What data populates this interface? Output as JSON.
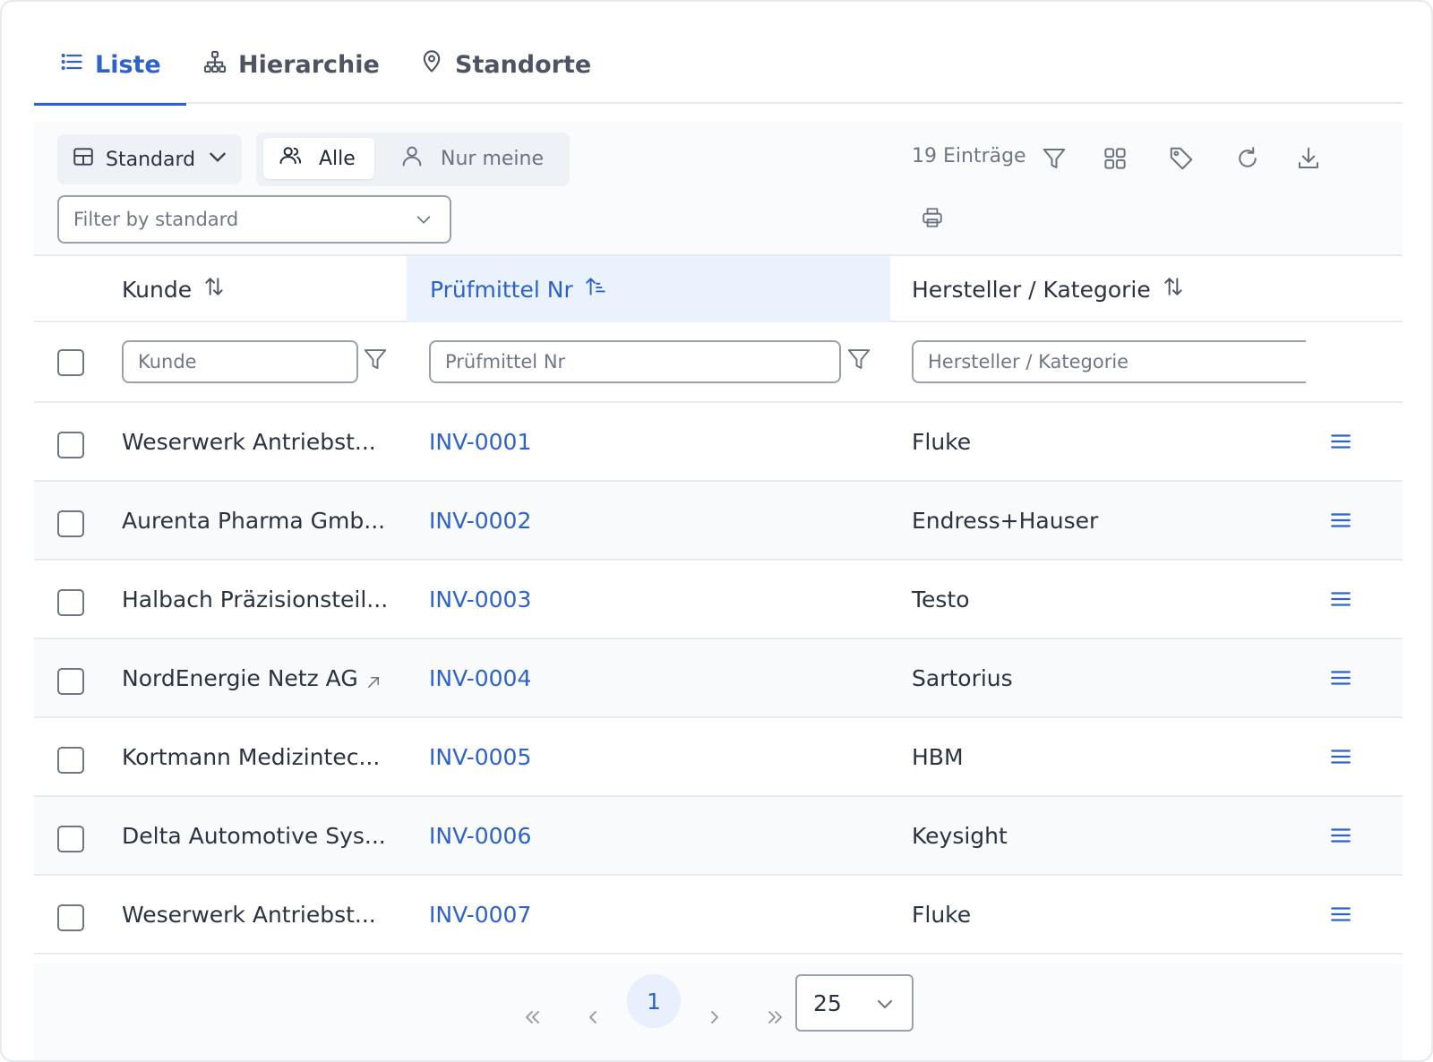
{
  "tabs": [
    {
      "label": "Liste",
      "icon": "list-icon",
      "active": true
    },
    {
      "label": "Hierarchie",
      "icon": "hierarchy-icon",
      "active": false
    },
    {
      "label": "Standorte",
      "icon": "location-pin-icon",
      "active": false
    }
  ],
  "toolbar": {
    "view_label": "Standard",
    "seg_all": "Alle",
    "seg_mine": "Nur meine",
    "filter_placeholder": "Filter by standard",
    "entries": "19 Einträge"
  },
  "table": {
    "headers": {
      "kunde": "Kunde",
      "pruefmittel": "Prüfmittel Nr",
      "hersteller": "Hersteller / Kategorie"
    },
    "filters": {
      "kunde": "Kunde",
      "pruefmittel": "Prüfmittel Nr",
      "hersteller": "Hersteller / Kategorie"
    },
    "rows": [
      {
        "kunde": "Weserwerk Antriebst...",
        "nr": "INV-0001",
        "hersteller": "Fluke"
      },
      {
        "kunde": "Aurenta Pharma Gmb...",
        "nr": "INV-0002",
        "hersteller": "Endress+Hauser"
      },
      {
        "kunde": "Halbach Präzisionsteil...",
        "nr": "INV-0003",
        "hersteller": "Testo"
      },
      {
        "kunde": "NordEnergie Netz AG",
        "nr": "INV-0004",
        "hersteller": "Sartorius"
      },
      {
        "kunde": "Kortmann Medizintec...",
        "nr": "INV-0005",
        "hersteller": "HBM"
      },
      {
        "kunde": "Delta Automotive Sys...",
        "nr": "INV-0006",
        "hersteller": "Keysight"
      },
      {
        "kunde": "Weserwerk Antriebst...",
        "nr": "INV-0007",
        "hersteller": "Fluke"
      }
    ]
  },
  "pagination": {
    "current_page": "1",
    "page_size": "25"
  },
  "colors": {
    "accent": "#2d63c8",
    "header_highlight": "#eaf2fd"
  }
}
